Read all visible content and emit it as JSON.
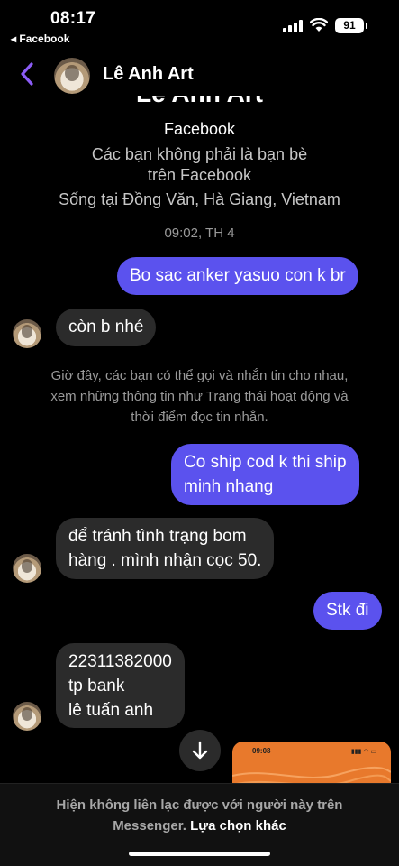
{
  "status_bar": {
    "time": "08:17",
    "back_app": "◂ Facebook",
    "battery": "91"
  },
  "header": {
    "contact_name": "Lê Anh Art"
  },
  "profile": {
    "name": "Lê Anh Art",
    "platform": "Facebook",
    "friend_status_line1": "Các bạn không phải là bạn bè",
    "friend_status_line2": "trên Facebook",
    "location": "Sống tại Đồng Văn, Hà Giang, Vietnam"
  },
  "timestamp": "09:02, TH 4",
  "messages": [
    {
      "side": "out",
      "lines": [
        "Bo sac anker yasuo con k br"
      ]
    },
    {
      "side": "in",
      "lines": [
        "còn b nhé"
      ]
    },
    {
      "side": "out",
      "lines": [
        "Co ship cod k thi ship",
        "minh nhang"
      ]
    },
    {
      "side": "in",
      "lines": [
        "để tránh tình trạng bom",
        "hàng . mình nhận cọc 50."
      ]
    },
    {
      "side": "out",
      "lines": [
        "Stk đi"
      ]
    },
    {
      "side": "in",
      "lines": [
        "22311382000",
        "tp bank",
        "lê tuấn anh"
      ]
    }
  ],
  "notice": {
    "line1": "Giờ đây, các bạn có thể gọi và nhắn tin cho nhau,",
    "line2": "xem những thông tin như Trạng thái hoạt động và",
    "line3": "thời điểm đọc tin nhắn."
  },
  "image_preview": {
    "time": "09:08"
  },
  "footer": {
    "text_line1": "Hiện không liên lạc được với người này trên",
    "text_line2_prefix": "Messenger.",
    "link": "Lựa chọn khác"
  },
  "colors": {
    "outgoing_bubble": "#5b52ee",
    "incoming_bubble": "#2b2b2b",
    "accent_back": "#8b5cf6",
    "preview_image": "#e8792c"
  }
}
